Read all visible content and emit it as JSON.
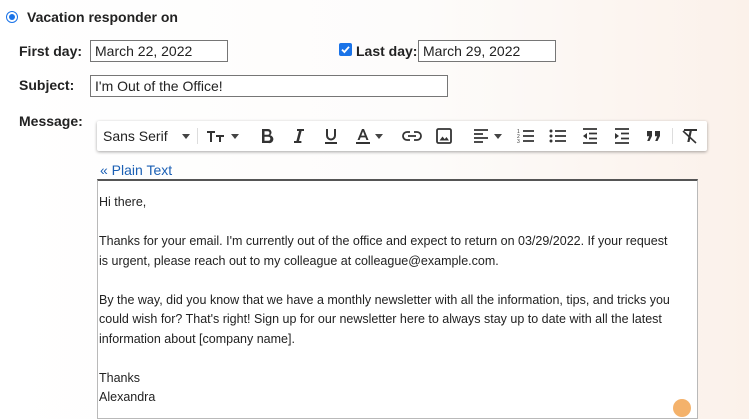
{
  "responder": {
    "label": "Vacation responder on",
    "selected": true,
    "accent": "#1a73e8"
  },
  "first_day": {
    "label": "First day:",
    "value": "March 22, 2022"
  },
  "last_day": {
    "label": "Last day:",
    "checked": true,
    "value": "March 29, 2022"
  },
  "subject": {
    "label": "Subject:",
    "value": "I'm Out of the Office!"
  },
  "message": {
    "label": "Message:",
    "plain_text_link": "« Plain Text",
    "paragraphs": [
      "Hi there,",
      "Thanks for your email. I'm currently out of the office and expect to return on 03/29/2022. If your request\nis urgent, please reach out to my colleague at colleague@example.com.",
      "By the way, did you know that we have a monthly newsletter with all the information, tips, and tricks you\ncould wish for? That's right! Sign up for our newsletter here to always stay up to date with all the latest\ninformation about [company name].",
      "Thanks\nAlexandra"
    ]
  },
  "toolbar": {
    "font_name": "Sans Serif",
    "icons": [
      "font-size-icon",
      "bold-icon",
      "italic-icon",
      "underline-icon",
      "text-color-icon",
      "link-icon",
      "image-icon",
      "align-icon",
      "numbered-list-icon",
      "bulleted-list-icon",
      "indent-less-icon",
      "indent-more-icon",
      "quote-icon",
      "remove-formatting-icon"
    ]
  }
}
